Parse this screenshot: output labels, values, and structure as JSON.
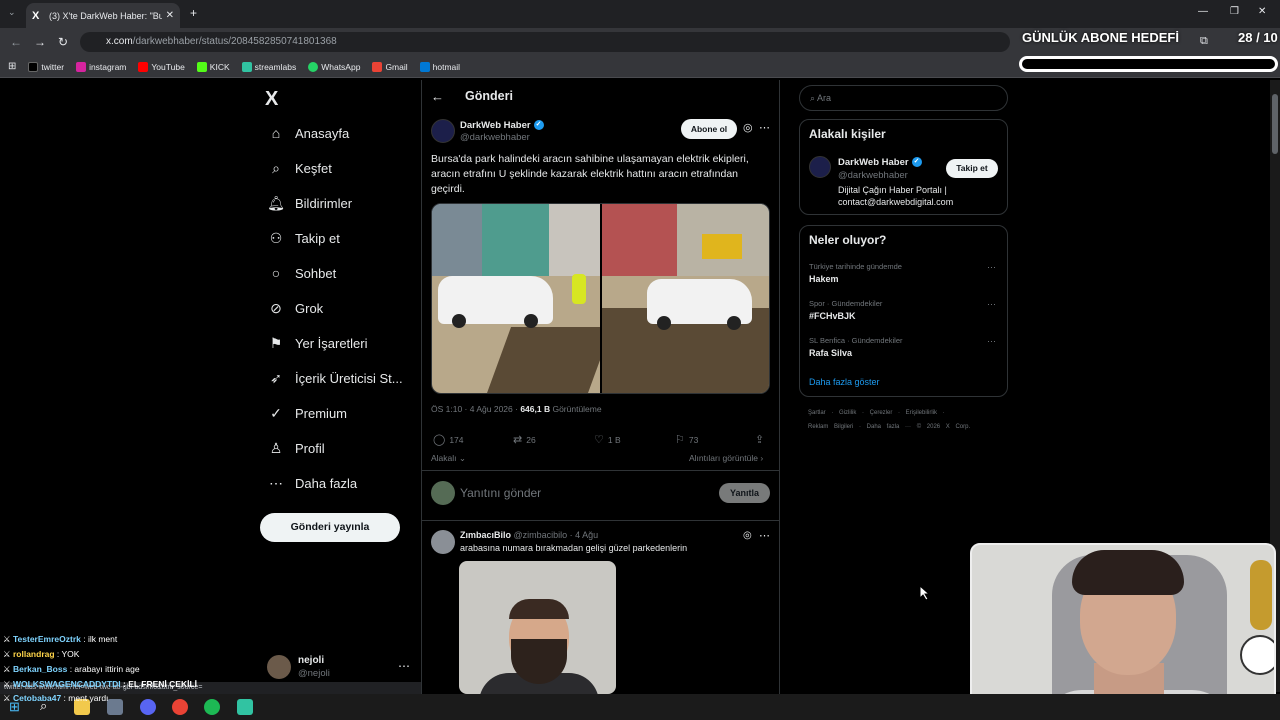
{
  "browser": {
    "tab_title": "(3) X'te DarkWeb Haber: \"Bursa",
    "url_host": "x.com",
    "url_path": "/darkwebhaber/status/2084582850741801368",
    "bookmarks": [
      "twitter",
      "instagram",
      "YouTube",
      "KICK",
      "streamlabs",
      "WhatsApp",
      "Gmail",
      "hotmail"
    ]
  },
  "overlay": {
    "goal_title": "GÜNLÜK ABONE HEDEFİ",
    "goal_count": "28 / 10"
  },
  "nav": {
    "logo": "X",
    "items": [
      "Anasayfa",
      "Keşfet",
      "Bildirimler",
      "Takip et",
      "Sohbet",
      "Grok",
      "Yer İşaretleri",
      "İçerik Üreticisi St...",
      "Premium",
      "Profil",
      "Daha fazla"
    ],
    "post_button": "Gönderi yayınla",
    "user_name": "nejoli",
    "user_handle": "@nejoli"
  },
  "main": {
    "title": "Gönderi",
    "author_name": "DarkWeb Haber",
    "author_handle": "@darkwebhaber",
    "subscribe": "Abone ol",
    "text": "Bursa'da park halindeki aracın sahibine ulaşamayan elektrik ekipleri, aracın etrafını U şeklinde kazarak elektrik hattını aracın etrafından geçirdi.",
    "time": "ÖS 1:10 · 4 Ağu 2026 · ",
    "views": "646,1 B",
    "views_label": " Görüntüleme",
    "stats": {
      "replies": "174",
      "reposts": "26",
      "likes": "1 B",
      "bookmarks": "73"
    },
    "related": "Alakalı",
    "quotes": "Alıntıları görüntüle ›",
    "reply_placeholder": "Yanıtını gönder",
    "reply_button": "Yanıtla",
    "reply2": {
      "name": "ZımbacıBilo",
      "meta": " @zimbacibilo · 4 Ağu",
      "text": "arabasına numara bırakmadan gelişi güzel parkedenlerin"
    }
  },
  "sidebar": {
    "search_placeholder": "Ara",
    "related_title": "Alakalı kişiler",
    "rp_name": "DarkWeb Haber",
    "rp_handle": "@darkwebhaber",
    "rp_bio1": "Dijital Çağın Haber Portalı |",
    "rp_bio2": "contact@darkwebdigital.com",
    "follow": "Takip et",
    "trends_title": "Neler oluyor?",
    "trends": [
      {
        "cat": "Türkiye tarihinde gündemde",
        "name": "Hakem"
      },
      {
        "cat": "Spor · Gündemdekiler",
        "name": "#FCHvBJK"
      },
      {
        "cat": "SL Benfica · Gündemdekiler",
        "name": "Rafa Silva"
      }
    ],
    "show_more": "Daha fazla göster",
    "footer1": "Şartlar · Gizlilik · Çerezler · Erişilebilirlik ·",
    "footer2": "Reklam Bilgileri · Daha fazla ··· © 2026 X Corp."
  },
  "chat": [
    {
      "user": "TesterEmreOztrk",
      "msg": " : ilk ment",
      "color": "#7fd4ff"
    },
    {
      "user": "rollandrag",
      "msg": " : YOK",
      "color": "#ffd54a"
    },
    {
      "user": "Berkan_Boss",
      "msg": " : arabayı ittirin age",
      "color": "#7fd4ff"
    },
    {
      "user": "WOLKSWAGENCADDYTDI",
      "msg": " : EL FRENİ ÇEKİLİ",
      "color": "#7fd4ff"
    },
    {
      "user": "Cetobaba47",
      "msg": " : ment yardı",
      "color": "#7fd4ff"
    }
  ],
  "status_url": "twitter-ads-work.html?ref=web-twc-ao-gbl-adsinfo&utm_source="
}
